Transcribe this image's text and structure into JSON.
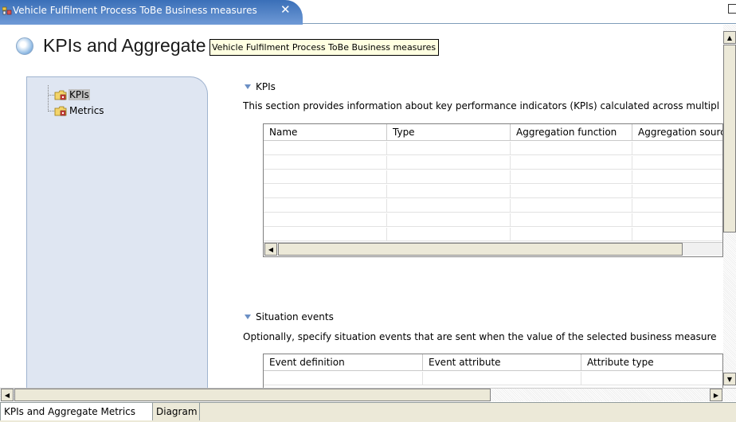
{
  "editor_tab": {
    "title": "Vehicle Fulfilment Process ToBe Business measures",
    "close": "✕"
  },
  "header": {
    "title": "KPIs and Aggregate Metrics",
    "tooltip": "Vehicle Fulfilment Process ToBe Business measures"
  },
  "tree": {
    "items": [
      {
        "label": "KPIs",
        "selected": true
      },
      {
        "label": "Metrics",
        "selected": false
      }
    ]
  },
  "kpis_section": {
    "title": "KPIs",
    "description": "This section provides information about key performance indicators (KPIs) calculated across multipl",
    "columns": [
      "Name",
      "Type",
      "Aggregation function",
      "Aggregation source"
    ],
    "row_count": 8
  },
  "situation_section": {
    "title": "Situation events",
    "description": "Optionally, specify situation events that are sent when the value of the selected business measure",
    "columns": [
      "Event definition",
      "Event attribute",
      "Attribute type"
    ]
  },
  "page_tabs": [
    {
      "label": "KPIs and Aggregate Metrics",
      "active": true
    },
    {
      "label": "Diagram",
      "active": false
    }
  ],
  "colors": {
    "tab_active": "#3a6fb8",
    "tree_panel": "#dfe6f2",
    "tooltip_bg": "#ffffe1",
    "section_triangle": "#6b8fc4"
  },
  "icons": {
    "editor_tab": "business-measures-icon",
    "header": "kpi-editor-icon",
    "tree_folder": "folder-icon"
  }
}
